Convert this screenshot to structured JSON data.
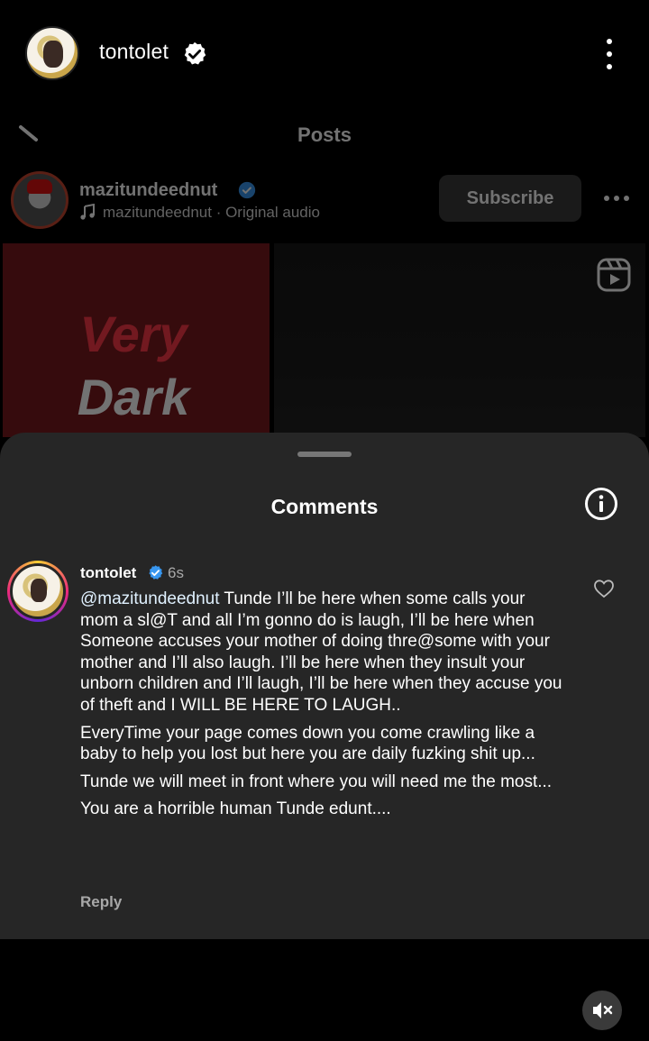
{
  "story": {
    "username": "tontolet",
    "verified": true
  },
  "underlying_post": {
    "section_title": "Posts",
    "author": "mazitundeednut",
    "audio": "mazitundeednut · Original audio",
    "subscribe_label": "Subscribe",
    "media_text_line1": "Very",
    "media_text_line2": "Dark"
  },
  "comments_sheet": {
    "title": "Comments",
    "comment": {
      "username": "tontolet",
      "time": "6s",
      "mention": "@mazitundeednut",
      "paragraph1_rest": " Tunde I’ll be here when some calls your mom a sl@T and all I’m gonno do is laugh, I’ll be here when Someone accuses your mother of doing thre@some with your mother and I’ll also laugh. I’ll be here when they insult your unborn children and I’ll laugh, I’ll be here when they accuse you of theft and I WILL BE HERE TO LAUGH..",
      "paragraph2": "EveryTime your page comes down you come crawling like a baby to help you lost but here you are daily fuzking shit up...",
      "paragraph3": "Tunde we will meet in front where you will need me the most...",
      "paragraph4": "You are a horrible human Tunde edunt....",
      "reply_label": "Reply"
    }
  },
  "colors": {
    "background": "#000000",
    "sheet": "#262626",
    "verified_blue": "#3897f0",
    "secondary_text": "#a8a8a8"
  }
}
